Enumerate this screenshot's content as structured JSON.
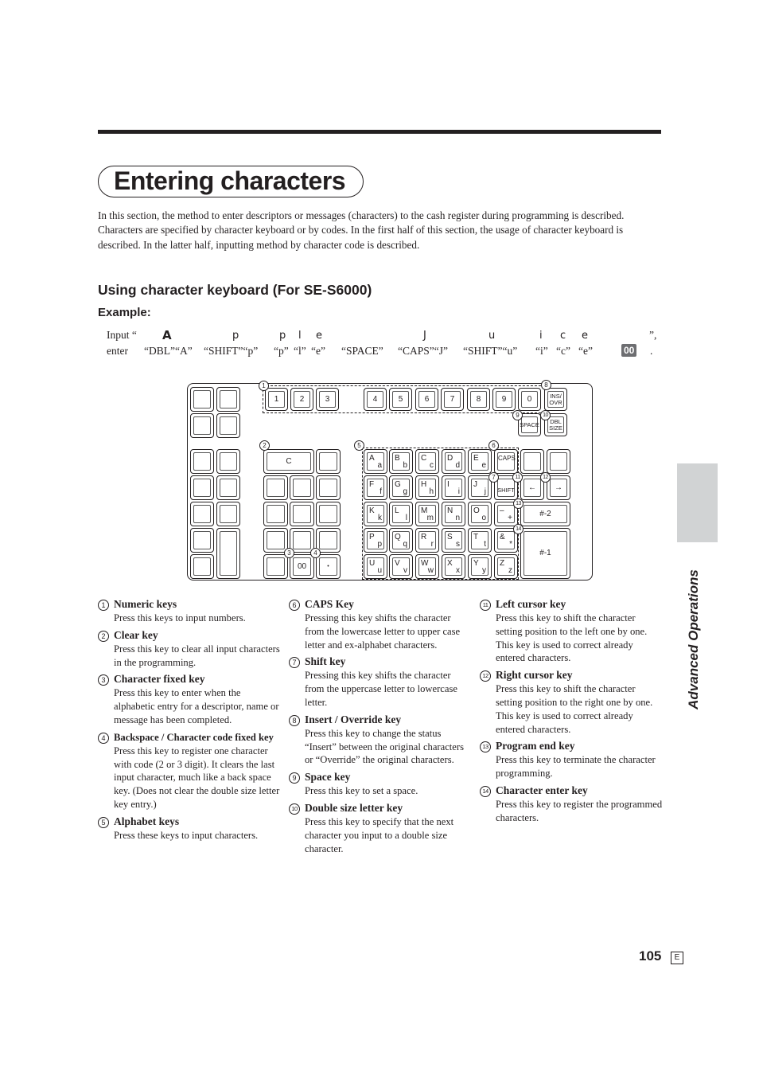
{
  "page": {
    "title": "Entering characters",
    "intro": [
      "In this section, the method to enter descriptors or messages (characters) to the cash register during programming is described.",
      "Characters are specified by character keyboard or by codes. In the first half of this section, the usage of character keyboard is described. In the latter half, inputting method by character code is described."
    ],
    "section_heading": "Using character keyboard (For SE-S6000)",
    "example_heading": "Example:",
    "side_tab_label": "Advanced Operations",
    "page_number": "105",
    "language_badge": "E"
  },
  "example": {
    "input_prefix": "Input “",
    "input_suffix": "”,",
    "enter_prefix": "enter",
    "enter_suffix": ".",
    "chars": [
      "A",
      "p",
      "p",
      "l",
      "e",
      "J",
      "u",
      "i",
      "c",
      "e"
    ],
    "steps": [
      "“DBL”“A”",
      "“SHIFT”“p”",
      "“p”",
      "“l”",
      "“e”",
      "“SPACE”",
      "“CAPS”“J”",
      "“SHIFT”“u”",
      "“i”",
      "“c”",
      "“e”"
    ],
    "final_key": "00"
  },
  "keyboard": {
    "number_keys": [
      "1",
      "2",
      "3",
      "4",
      "5",
      "6",
      "7",
      "8",
      "9",
      "0"
    ],
    "ins_ovr": "INS/ OVR",
    "space": "SPACE",
    "dbl_size": "DBL SIZE",
    "clear": "C",
    "double_zero": "00",
    "point": "•",
    "caps": "CAPS",
    "shift": "SHIFT",
    "left_arrow": "←",
    "right_arrow": "→",
    "minus_plus_upper": "–",
    "minus_plus_lower": "+",
    "amp_upper": "&",
    "amp_lower": "*",
    "program_end": "#-2",
    "char_enter": "#-1",
    "alpha_rows": [
      [
        [
          "A",
          "a"
        ],
        [
          "B",
          "b"
        ],
        [
          "C",
          "c"
        ],
        [
          "D",
          "d"
        ],
        [
          "E",
          "e"
        ]
      ],
      [
        [
          "F",
          "f"
        ],
        [
          "G",
          "g"
        ],
        [
          "H",
          "h"
        ],
        [
          "I",
          "i"
        ],
        [
          "J",
          "j"
        ]
      ],
      [
        [
          "K",
          "k"
        ],
        [
          "L",
          "l"
        ],
        [
          "M",
          "m"
        ],
        [
          "N",
          "n"
        ],
        [
          "O",
          "o"
        ]
      ],
      [
        [
          "P",
          "p"
        ],
        [
          "Q",
          "q"
        ],
        [
          "R",
          "r"
        ],
        [
          "S",
          "s"
        ],
        [
          "T",
          "t"
        ]
      ],
      [
        [
          "U",
          "u"
        ],
        [
          "V",
          "v"
        ],
        [
          "W",
          "w"
        ],
        [
          "X",
          "x"
        ],
        [
          "Y",
          "y"
        ],
        [
          "Z",
          "z"
        ]
      ]
    ],
    "callouts": [
      "1",
      "2",
      "3",
      "4",
      "5",
      "6",
      "7",
      "8",
      "9",
      "10",
      "11",
      "12",
      "13",
      "14"
    ]
  },
  "descriptions": [
    {
      "num": "1",
      "title": "Numeric keys",
      "body": "Press this keys to input numbers."
    },
    {
      "num": "2",
      "title": "Clear key",
      "body": "Press this key to clear all input characters in the programming."
    },
    {
      "num": "3",
      "title": "Character fixed key",
      "body": "Press this key to enter when the alphabetic entry for a descriptor, name or message has been completed."
    },
    {
      "num": "4",
      "title": "Backspace / Character code fixed key",
      "body": "Press this key to register one character with code (2 or 3 digit). It clears the last input character, much like a back space key. (Does not clear the double size letter key entry.)"
    },
    {
      "num": "5",
      "title": "Alphabet keys",
      "body": "Press these keys to input characters."
    },
    {
      "num": "6",
      "title": "CAPS Key",
      "body": "Pressing this key shifts the character from the lowercase letter to upper case letter and ex-alphabet characters."
    },
    {
      "num": "7",
      "title": "Shift key",
      "body": "Pressing this key shifts the character from the uppercase letter to lowercase letter."
    },
    {
      "num": "8",
      "title": "Insert / Override key",
      "body": "Press this key to change the status “Insert” between the original characters or “Override” the original characters."
    },
    {
      "num": "9",
      "title": "Space key",
      "body": "Press this key to set a space."
    },
    {
      "num": "10",
      "title": "Double size letter key",
      "body": "Press this key to specify that the next character you input to a double size character."
    },
    {
      "num": "11",
      "title": "Left cursor key",
      "body": "Press this key to shift the character setting position to the left one by one. This key is used to correct already entered characters."
    },
    {
      "num": "12",
      "title": "Right cursor key",
      "body": "Press this key to shift the character setting position to the right one by one. This key is used to correct already entered characters."
    },
    {
      "num": "13",
      "title": "Program end key",
      "body": "Press this key to terminate the character programming."
    },
    {
      "num": "14",
      "title": "Character enter key",
      "body": "Press this key to register the programmed characters."
    }
  ]
}
